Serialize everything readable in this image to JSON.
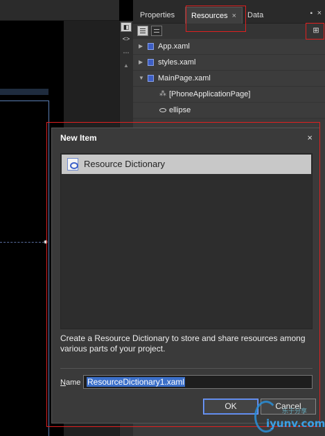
{
  "panel": {
    "tabs": [
      {
        "label": "Properties"
      },
      {
        "label": "Resources",
        "close": "×"
      },
      {
        "label": "Data"
      }
    ],
    "pin_icon": "pin-icon",
    "close_icon": "close-icon"
  },
  "tree": {
    "items": [
      {
        "label": "App.xaml",
        "expander": "▶"
      },
      {
        "label": "styles.xaml",
        "expander": "▶"
      },
      {
        "label": "MainPage.xaml",
        "expander": "▼"
      },
      {
        "label": "[PhoneApplicationPage]"
      },
      {
        "label": "ellipse"
      }
    ]
  },
  "dialog": {
    "title": "New Item",
    "close": "×",
    "items": [
      {
        "label": "Resource Dictionary",
        "selected": true,
        "icon": "resource-dictionary-icon"
      }
    ],
    "description": "Create a Resource Dictionary to store and share resources among various parts of your project.",
    "name_label_underlined": "N",
    "name_label_rest": "ame",
    "name_value": "ResourceDictionary1.xaml",
    "ok_label": "OK",
    "cancel_label": "Cancel"
  },
  "watermark": {
    "text": "iyunv.com",
    "small": "乐于分享"
  },
  "colors": {
    "annotation": "#e02020",
    "selection": "#3b6fc9",
    "panel_bg": "#3a3a3a"
  }
}
